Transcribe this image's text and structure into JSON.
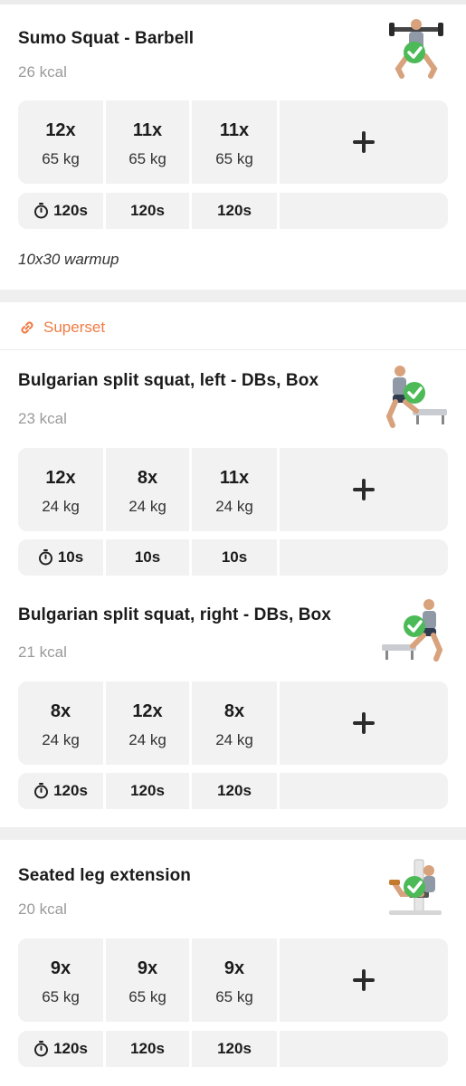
{
  "exercises": [
    {
      "title": "Sumo Squat - Barbell",
      "kcal": "26 kcal",
      "sets": [
        {
          "reps": "12x",
          "weight": "65 kg"
        },
        {
          "reps": "11x",
          "weight": "65 kg"
        },
        {
          "reps": "11x",
          "weight": "65 kg"
        }
      ],
      "rests": [
        "120s",
        "120s",
        "120s"
      ],
      "note": "10x30 warmup"
    },
    {
      "title": "Bulgarian split squat, left - DBs, Box",
      "kcal": "23 kcal",
      "sets": [
        {
          "reps": "12x",
          "weight": "24 kg"
        },
        {
          "reps": "8x",
          "weight": "24 kg"
        },
        {
          "reps": "11x",
          "weight": "24 kg"
        }
      ],
      "rests": [
        "10s",
        "10s",
        "10s"
      ]
    },
    {
      "title": "Bulgarian split squat, right - DBs, Box",
      "kcal": "21 kcal",
      "sets": [
        {
          "reps": "8x",
          "weight": "24 kg"
        },
        {
          "reps": "12x",
          "weight": "24 kg"
        },
        {
          "reps": "8x",
          "weight": "24 kg"
        }
      ],
      "rests": [
        "120s",
        "120s",
        "120s"
      ]
    },
    {
      "title": "Seated leg extension",
      "kcal": "20 kcal",
      "sets": [
        {
          "reps": "9x",
          "weight": "65 kg"
        },
        {
          "reps": "9x",
          "weight": "65 kg"
        },
        {
          "reps": "9x",
          "weight": "65 kg"
        }
      ],
      "rests": [
        "120s",
        "120s",
        "120s"
      ]
    }
  ],
  "superset": {
    "label": "Superset",
    "icon": "link-icon"
  },
  "icons": {
    "timer": "timer-icon",
    "add": "plus-icon",
    "completed": "check-badge-icon"
  },
  "colors": {
    "accent": "#ef7c45",
    "check": "#4cba57",
    "cell": "#f2f2f2"
  }
}
